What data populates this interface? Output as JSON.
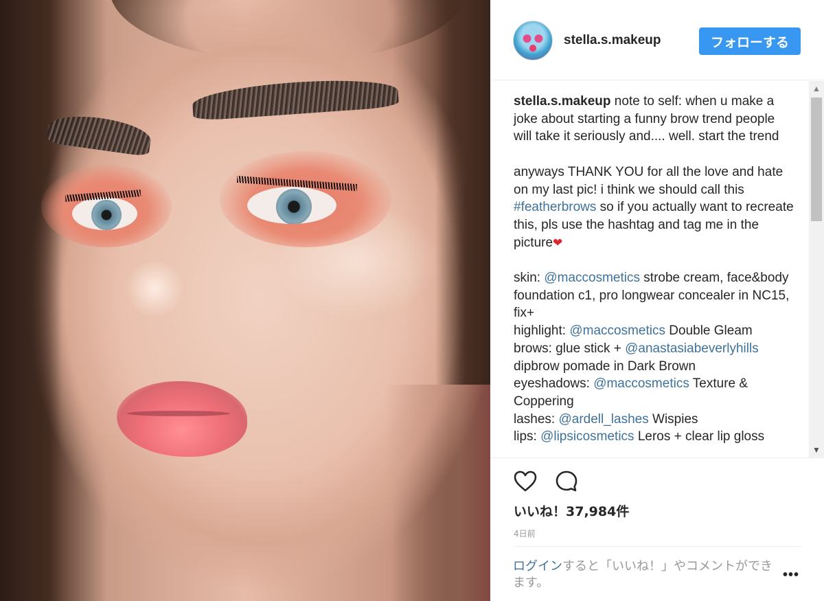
{
  "post": {
    "image_alt": "close-up selfie with feather brows and coral eyeshadow"
  },
  "header": {
    "username": "stella.s.makeup",
    "follow_label": "フォローする"
  },
  "caption": {
    "author": "stella.s.makeup",
    "p1": " note to self: when u make a joke about starting a funny brow trend people will take it seriously and.... well. start the trend",
    "p2_a": "anyways THANK YOU for all the love and hate on my last pic! i think we should call this ",
    "p2_hashtag": "#featherbrows",
    "p2_b": " so if you actually want to recreate this, pls use the hashtag and tag me in the picture",
    "p2_emoji": "❤",
    "skin_label": "skin: ",
    "mention_mac": "@maccosmetics",
    "skin_text": " strobe cream, face&body foundation c1, pro longwear concealer in NC15, fix+",
    "highlight_label": "highlight: ",
    "highlight_text": " Double Gleam",
    "brows_label": "brows: glue stick + ",
    "mention_abh": "@anastasiabeverlyhills",
    "brows_text": " dipbrow pomade in Dark Brown",
    "eyeshadows_label": "eyeshadows: ",
    "eyeshadows_text": " Texture & Coppering",
    "lashes_label": "lashes: ",
    "mention_ardell": "@ardell_lashes",
    "lashes_text": " Wispies",
    "lips_label": "lips: ",
    "mention_lipsi": "@lipsicosmetics",
    "lips_text": " Leros + clear lip gloss"
  },
  "scrollbar": {
    "up_glyph": "▲",
    "down_glyph": "▼"
  },
  "actions": {
    "likes": "いいね！37,984件",
    "time": "4日前"
  },
  "login": {
    "link": "ログイン",
    "text": "すると「いいね！」やコメントができます。",
    "more": "•••"
  },
  "colors": {
    "accent": "#3897f0",
    "link": "#3f729b",
    "text": "#262626",
    "muted": "#999999"
  }
}
